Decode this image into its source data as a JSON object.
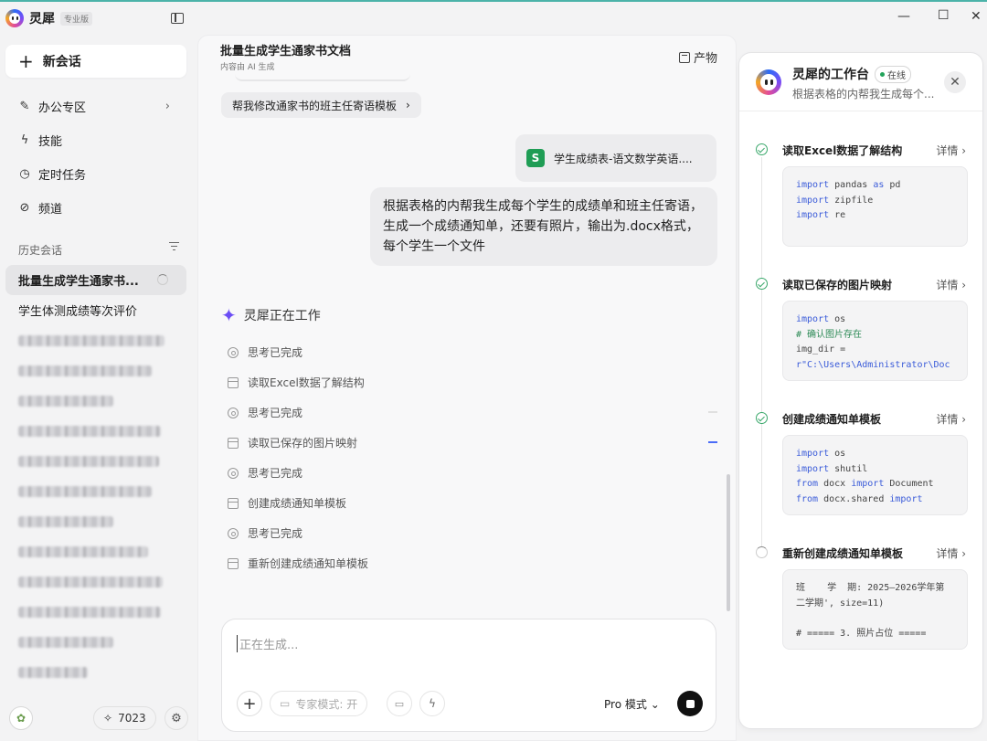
{
  "app": {
    "name": "灵犀",
    "edition_badge": "专业版"
  },
  "colors": {
    "accent": "#4a6cf7",
    "success": "#3aa86b",
    "excel_green": "#1f9d55",
    "brand_purple": "#6b4df5"
  },
  "sidebar": {
    "new_chat_label": "新会话",
    "nav": [
      {
        "label": "办公专区",
        "icon": "pen-icon"
      },
      {
        "label": "技能",
        "icon": "bolt-icon"
      },
      {
        "label": "定时任务",
        "icon": "clock-icon"
      },
      {
        "label": "频道",
        "icon": "link-icon"
      }
    ],
    "history_title": "历史会话",
    "history": [
      {
        "label": "批量生成学生通家书..."
      },
      {
        "label": "学生体测成绩等次评价"
      }
    ],
    "credits": "7023"
  },
  "main": {
    "title": "批量生成学生通家书文档",
    "subtitle": "内容由 AI 生成",
    "artifact_label": "产物",
    "suggestion": "帮我修改通家书的班主任寄语模板",
    "attachment_name": "学生成绩表-语文数学英语....",
    "user_message": "根据表格的内帮我生成每个学生的成绩单和班主任寄语，生成一个成绩通知单，还要有照片，输出为.docx格式，每个学生一个文件",
    "working_label": "灵犀正在工作",
    "steps": [
      {
        "label": "思考已完成",
        "kind": "think"
      },
      {
        "label": "读取Excel数据了解结构",
        "kind": "doc"
      },
      {
        "label": "思考已完成",
        "kind": "think"
      },
      {
        "label": "读取已保存的图片映射",
        "kind": "doc"
      },
      {
        "label": "思考已完成",
        "kind": "think"
      },
      {
        "label": "创建成绩通知单模板",
        "kind": "doc"
      },
      {
        "label": "思考已完成",
        "kind": "think"
      },
      {
        "label": "重新创建成绩通知单模板",
        "kind": "doc"
      }
    ],
    "composer": {
      "placeholder": "正在生成...",
      "expert_mode": "专家模式: 开",
      "model_mode": "Pro 模式"
    }
  },
  "workbench": {
    "title": "灵犀的工作台",
    "status": "在线",
    "subtitle": "根据表格的内帮我生成每个...",
    "detail_label": "详情",
    "tasks": [
      {
        "name": "读取Excel数据了解结构",
        "status": "done",
        "code": [
          "import pandas as pd",
          "import zipfile",
          "import re"
        ]
      },
      {
        "name": "读取已保存的图片映射",
        "status": "done",
        "code": [
          "import os",
          "# 确认图片存在",
          "img_dir =",
          "r\"C:\\Users\\Administrator\\Doc"
        ]
      },
      {
        "name": "创建成绩通知单模板",
        "status": "done",
        "code": [
          "import os",
          "import shutil",
          "from docx import Document",
          "from docx.shared import"
        ]
      },
      {
        "name": "重新创建成绩通知单模板",
        "status": "running",
        "code": [
          "班    学  期: 2025—2026学年第",
          "二学期', size=11)",
          "",
          "# ===== 3. 照片占位 ====="
        ]
      }
    ]
  }
}
